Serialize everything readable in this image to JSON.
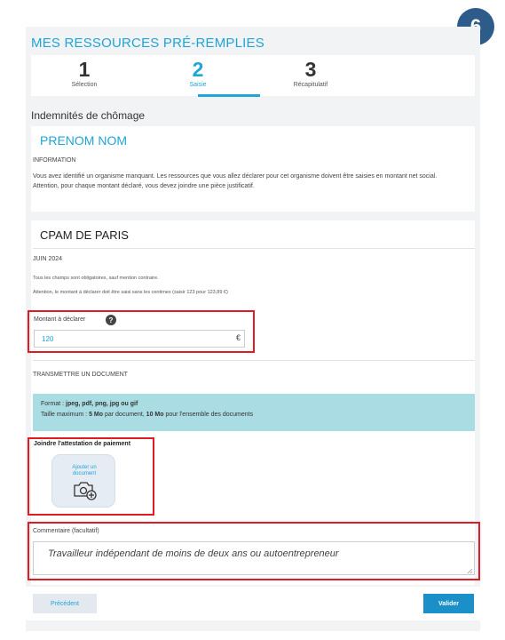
{
  "step_badge": "6",
  "page_title": "MES RESSOURCES PRÉ-REMPLIES",
  "stepper": [
    {
      "number": "1",
      "label": "Sélection"
    },
    {
      "number": "2",
      "label": "Saisie"
    },
    {
      "number": "3",
      "label": "Récapitulatif"
    }
  ],
  "section_title": "Indemnités de chômage",
  "person_name": "PRENOM NOM",
  "info": {
    "heading": "INFORMATION",
    "line1": "Vous avez identifié un organisme manquant. Les ressources que vous allez déclarer pour cet organisme doivent être saisies en montant net social.",
    "line2": "Attention, pour chaque montant déclaré, vous devez joindre une pièce justificatif."
  },
  "organisation": "CPAM DE PARIS",
  "period": "JUIN 2024",
  "notes": {
    "required": "Tous les champs sont obligatoires, sauf mention contraire.",
    "amount_rule": "Attention, le montant à déclarer doit être saisi sans les centimes (saisir 123 pour 123,89 €)"
  },
  "amount_field": {
    "label": "Montant à déclarer",
    "value": "120",
    "currency": "€"
  },
  "document_section": {
    "heading": "TRANSMETTRE UN DOCUMENT",
    "format_prefix": "Format : ",
    "format_values": "jpeg, pdf, png, jpg ou gif",
    "size_prefix": "Taille maximum : ",
    "size_doc": "5 Mo",
    "size_mid": " par document, ",
    "size_total": "10 Mo",
    "size_suffix": " pour l'ensemble des documents",
    "join_label": "Joindre l'attestation de paiement",
    "add_line1": "Ajouter un",
    "add_line2": "document"
  },
  "comment": {
    "label": "Commentaire (facultatif)",
    "value": "Travailleur indépendant de moins de deux ans ou autoentrepreneur"
  },
  "buttons": {
    "previous": "Précédent",
    "validate": "Valider"
  },
  "colors": {
    "accent": "#1fa5d6",
    "highlight_border": "#e01b24",
    "info_box": "#a9dce3",
    "badge": "#2e5c8a",
    "primary_button": "#1b8fc7"
  }
}
